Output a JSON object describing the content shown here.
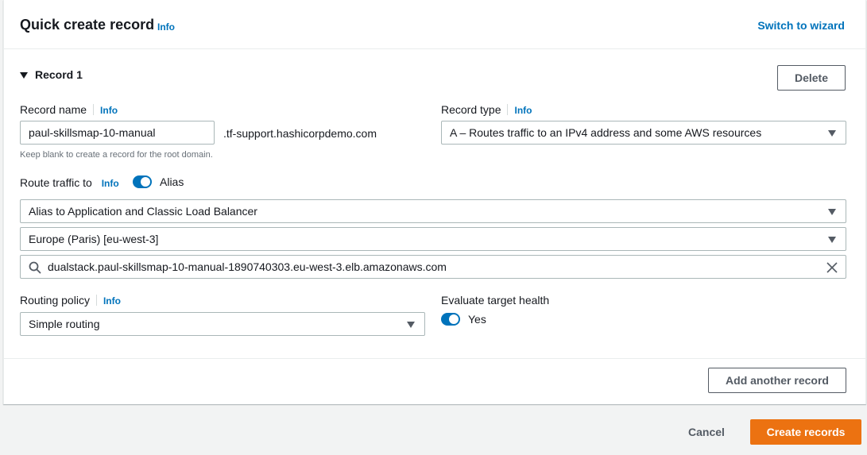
{
  "header": {
    "title": "Quick create record",
    "info": "Info",
    "switch_wizard": "Switch to wizard"
  },
  "record": {
    "toggle_label": "Record 1",
    "delete_label": "Delete",
    "record_name": {
      "label": "Record name",
      "info": "Info",
      "value": "paul-skillsmap-10-manual",
      "suffix": ".tf-support.hashicorpdemo.com",
      "hint": "Keep blank to create a record for the root domain."
    },
    "record_type": {
      "label": "Record type",
      "info": "Info",
      "value": "A – Routes traffic to an IPv4 address and some AWS resources"
    },
    "route_traffic": {
      "label": "Route traffic to",
      "info": "Info",
      "alias_label": "Alias",
      "alias_enabled": true,
      "endpoint_type": "Alias to Application and Classic Load Balancer",
      "region": "Europe (Paris) [eu-west-3]",
      "load_balancer": "dualstack.paul-skillsmap-10-manual-1890740303.eu-west-3.elb.amazonaws.com"
    },
    "routing_policy": {
      "label": "Routing policy",
      "info": "Info",
      "value": "Simple routing"
    },
    "evaluate_health": {
      "label": "Evaluate target health",
      "value_label": "Yes",
      "enabled": true
    }
  },
  "add_record_label": "Add another record",
  "footer": {
    "cancel_label": "Cancel",
    "create_label": "Create records"
  },
  "colors": {
    "link": "#0073bb",
    "primary": "#ec7211",
    "toggle_on": "#0073bb",
    "background": "#f2f3f3"
  }
}
